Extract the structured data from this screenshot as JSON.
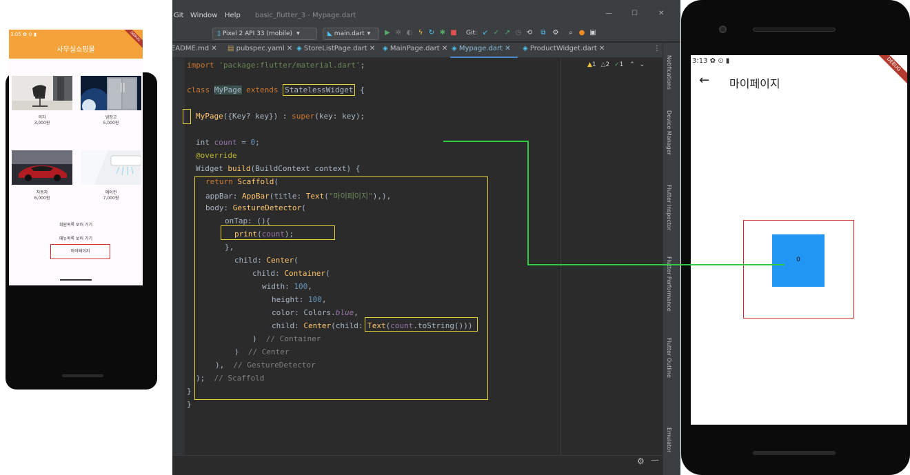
{
  "left_app": {
    "status_time": "3:05 ✿ ⊙ ▮",
    "debug_banner": "DEBUG",
    "title": "사무실쇼핑몰",
    "products": [
      {
        "name": "의자",
        "price": "3,000원"
      },
      {
        "name": "냉장고",
        "price": "5,000원"
      },
      {
        "name": "자동차",
        "price": "6,000원"
      },
      {
        "name": "에어컨",
        "price": "7,000원"
      }
    ],
    "links": [
      "회원목록 보러 가기",
      "메뉴목록 보러 가기"
    ],
    "mypage_button": "마이페이지"
  },
  "ide": {
    "menus": [
      "Git",
      "Window",
      "Help"
    ],
    "window_title": "basic_flutter_3 - Mypage.dart",
    "device_select": "Pixel 2 API 33 (mobile)",
    "run_config": "main.dart",
    "git_label": "Git:",
    "tabs": [
      "EADME.md",
      "pubspec.yaml",
      "StoreListPage.dart",
      "MainPage.dart",
      "Mypage.dart",
      "ProductWidget.dart"
    ],
    "inspections": {
      "warn_a": "1",
      "warn_b": "2",
      "ok": "1"
    },
    "side_tabs": [
      "Notifications",
      "Device Manager",
      "Flutter Inspector",
      "Flutter Performance",
      "Flutter Outline",
      "Emulator"
    ]
  },
  "right_app": {
    "status_time": "3:13 ✿ ⊙ ▮",
    "debug_banner": "DEBUG",
    "back_glyph": "←",
    "title": "마이페이지",
    "count_text": "0"
  },
  "colors": {
    "appbar_orange": "#f6a23a",
    "container_blue": "#2196f3",
    "highlight_yellow": "#e6d33a",
    "annotation_red": "#d62a2a",
    "annotation_green": "#2ecc40"
  }
}
